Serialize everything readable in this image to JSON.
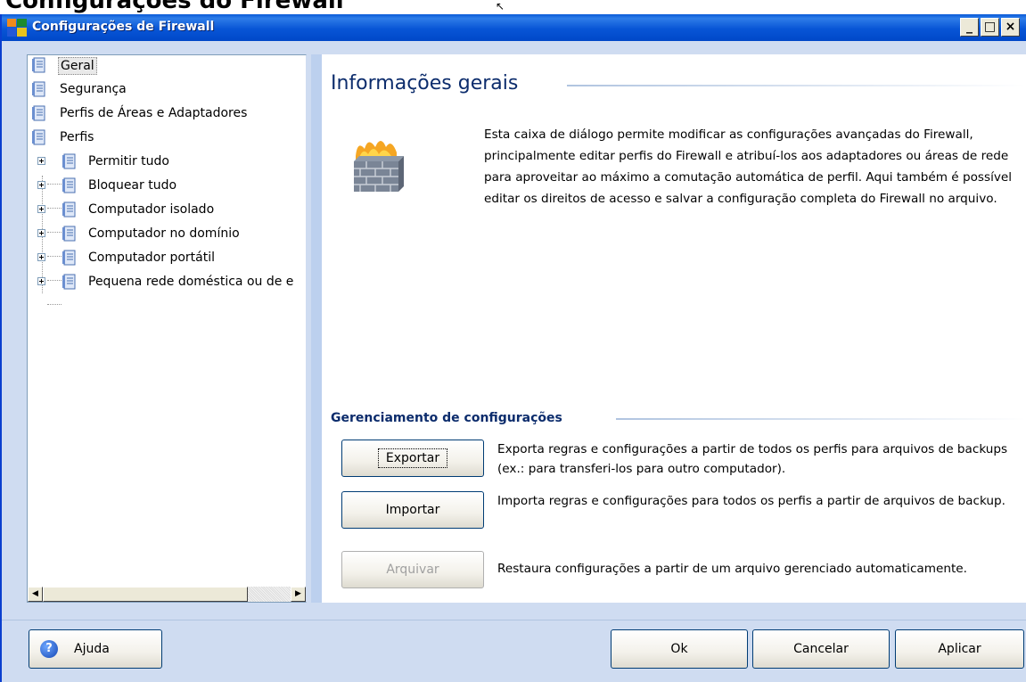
{
  "top_heading": "Configurações do Firewall",
  "window": {
    "title": "Configurações de Firewall",
    "minimize": "_",
    "maximize": "□",
    "close": "×"
  },
  "tree": {
    "items": [
      {
        "label": "Geral",
        "icon": "settings-page-icon"
      },
      {
        "label": "Segurança",
        "icon": "settings-page-icon"
      },
      {
        "label": "Perfis de Áreas e Adaptadores",
        "icon": "settings-page-icon"
      },
      {
        "label": "Perfis",
        "icon": "settings-page-icon"
      },
      {
        "label": "Permitir tudo",
        "icon": "profile-icon"
      },
      {
        "label": "Bloquear tudo",
        "icon": "profile-icon"
      },
      {
        "label": "Computador isolado",
        "icon": "profile-icon"
      },
      {
        "label": "Computador no domínio",
        "icon": "profile-icon"
      },
      {
        "label": "Computador portátil",
        "icon": "profile-icon"
      },
      {
        "label": "Pequena rede doméstica ou de e",
        "icon": "profile-icon"
      }
    ],
    "scroll_left": "◀",
    "scroll_right": "▶"
  },
  "main": {
    "title": "Informações gerais",
    "description": "Esta caixa de diálogo permite modificar as configurações avançadas do Firewall, principalmente editar perfis do Firewall e atribuí-los aos adaptadores ou áreas de rede para aproveitar ao máximo a comutação automática de perfil. Aqui também é possível editar os direitos de acesso e salvar a configuração completa do Firewall no arquivo.",
    "config_title": "Gerenciamento de configurações",
    "export": {
      "label": "Exportar",
      "desc": "Exporta regras e configurações a partir de todos os perfis para arquivos de backups (ex.: para transferi-los para outro computador)."
    },
    "import": {
      "label": "Importar",
      "desc": "Importa regras e configurações para todos os perfis a partir de arquivos de backup."
    },
    "archive": {
      "label": "Arquivar",
      "desc": "Restaura configurações a partir de um arquivo gerenciado automaticamente."
    }
  },
  "bottom": {
    "help": "Ajuda",
    "ok": "Ok",
    "cancel": "Cancelar",
    "apply": "Aplicar"
  }
}
